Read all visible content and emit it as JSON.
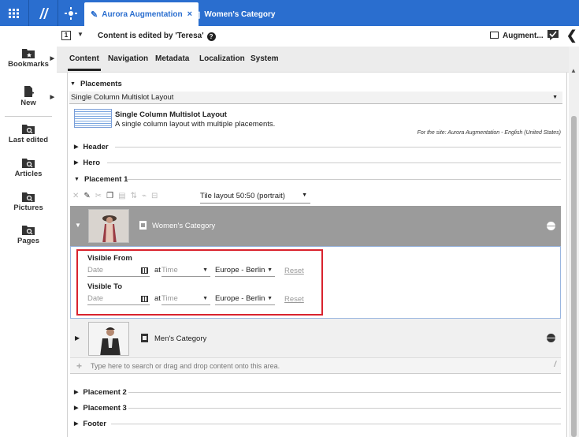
{
  "tabs": [
    {
      "label": "Aurora Augmentation",
      "close": "×"
    },
    {
      "label": "Women's Category"
    }
  ],
  "sidebar": {
    "items": [
      {
        "label": "Bookmarks",
        "icon": "bookmarks-folder-icon"
      },
      {
        "label": "New",
        "icon": "new-document-icon"
      },
      {
        "label": "Last edited",
        "icon": "search-folder-icon"
      },
      {
        "label": "Articles",
        "icon": "search-folder-icon"
      },
      {
        "label": "Pictures",
        "icon": "search-folder-icon"
      },
      {
        "label": "Pages",
        "icon": "search-folder-icon"
      }
    ]
  },
  "header": {
    "lock_label": "1",
    "message": "Content is edited by 'Teresa'",
    "help": "?",
    "augment_label": "Augment..."
  },
  "form_tabs": [
    "Content",
    "Navigation",
    "Metadata",
    "Localization",
    "System"
  ],
  "placements": {
    "title": "Placements",
    "layout_value": "Single Column Multislot Layout",
    "layout_name": "Single Column Multislot Layout",
    "layout_desc": "A single column layout with multiple placements.",
    "site_note": "For the site: Aurora Augmentation - English (United States)",
    "sections": [
      "Header",
      "Hero",
      "Placement 1",
      "Placement 2",
      "Placement 3",
      "Footer"
    ],
    "tile_layout": "Tile layout 50:50 (portrait)"
  },
  "items": [
    {
      "label": "Women's Category"
    },
    {
      "label": "Men's Category"
    }
  ],
  "visibility": {
    "from_label": "Visible From",
    "to_label": "Visible To",
    "date_placeholder": "Date",
    "at": "at",
    "time_placeholder": "Time",
    "timezone": "Europe - Berlin",
    "reset": "Reset"
  },
  "dropzone": {
    "placeholder": "Type here to search or drag and drop content onto this area."
  },
  "colors": {
    "accent": "#2a6ecf",
    "highlight": "#d9232e"
  }
}
